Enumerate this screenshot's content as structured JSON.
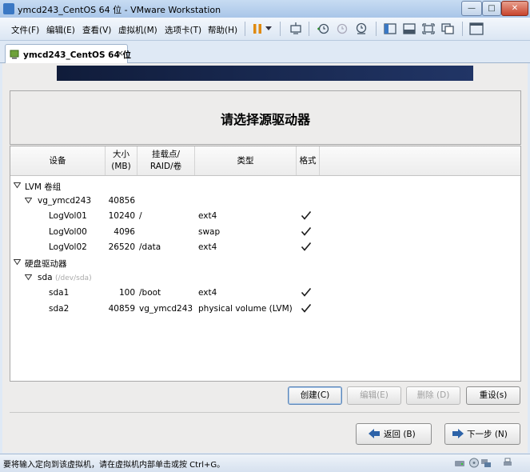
{
  "window": {
    "title": "ymcd243_CentOS 64 位 - VMware Workstation",
    "minimize": "—",
    "maximize": "□",
    "close": "✕"
  },
  "menu": [
    "文件(F)",
    "编辑(E)",
    "查看(V)",
    "虚拟机(M)",
    "选项卡(T)",
    "帮助(H)"
  ],
  "toolbar_icons": [
    "pause-icon",
    "dropdown-icon",
    "send-keys-icon",
    "snapshot-icon",
    "revert-snapshot-icon",
    "snapshot-manager-icon",
    "sidebar-icon",
    "thumbnail-icon",
    "fullscreen-icon",
    "unity-icon",
    "console-view-icon"
  ],
  "tab": {
    "label": "ymcd243_CentOS 64 位",
    "close": "×"
  },
  "installer": {
    "title": "请选择源驱动器",
    "columns": {
      "device": "设备",
      "size_line1": "大小",
      "size_line2": "(MB)",
      "mount_line1": "挂载点/",
      "mount_line2": "RAID/卷",
      "type": "类型",
      "format": "格式"
    },
    "rows": [
      {
        "level": 0,
        "expander": true,
        "device": "LVM 卷组",
        "size": "",
        "mount": "",
        "type": "",
        "format": false
      },
      {
        "level": 1,
        "expander": true,
        "device": "vg_ymcd243",
        "size": "40856",
        "mount": "",
        "type": "",
        "format": false
      },
      {
        "level": 2,
        "expander": false,
        "device": "LogVol01",
        "size": "10240",
        "mount": "/",
        "type": "ext4",
        "format": true
      },
      {
        "level": 2,
        "expander": false,
        "device": "LogVol00",
        "size": "4096",
        "mount": "",
        "type": "swap",
        "format": true
      },
      {
        "level": 2,
        "expander": false,
        "device": "LogVol02",
        "size": "26520",
        "mount": "/data",
        "type": "ext4",
        "format": true
      },
      {
        "level": 0,
        "expander": true,
        "device": "硬盘驱动器",
        "size": "",
        "mount": "",
        "type": "",
        "format": false
      },
      {
        "level": 1,
        "expander": true,
        "device": "sda",
        "hint": "(/dev/sda)",
        "size": "",
        "mount": "",
        "type": "",
        "format": false
      },
      {
        "level": 2,
        "expander": false,
        "device": "sda1",
        "size": "100",
        "mount": "/boot",
        "type": "ext4",
        "format": true
      },
      {
        "level": 2,
        "expander": false,
        "device": "sda2",
        "size": "40859",
        "mount": "vg_ymcd243",
        "type": "physical volume (LVM)",
        "format": true
      }
    ],
    "buttons": {
      "create": "创建(C)",
      "edit": "编辑(E)",
      "delete": "删除 (D)",
      "reset": "重设(s)"
    },
    "nav": {
      "back": "返回 (B)",
      "next": "下一步 (N)"
    }
  },
  "status": {
    "message": "要将输入定向到该虚拟机，请在虚拟机内部单击或按 Ctrl+G。"
  },
  "colors": {
    "accent": "#3a78c4",
    "banner": "#16244a",
    "check": "#1a1a1a"
  }
}
